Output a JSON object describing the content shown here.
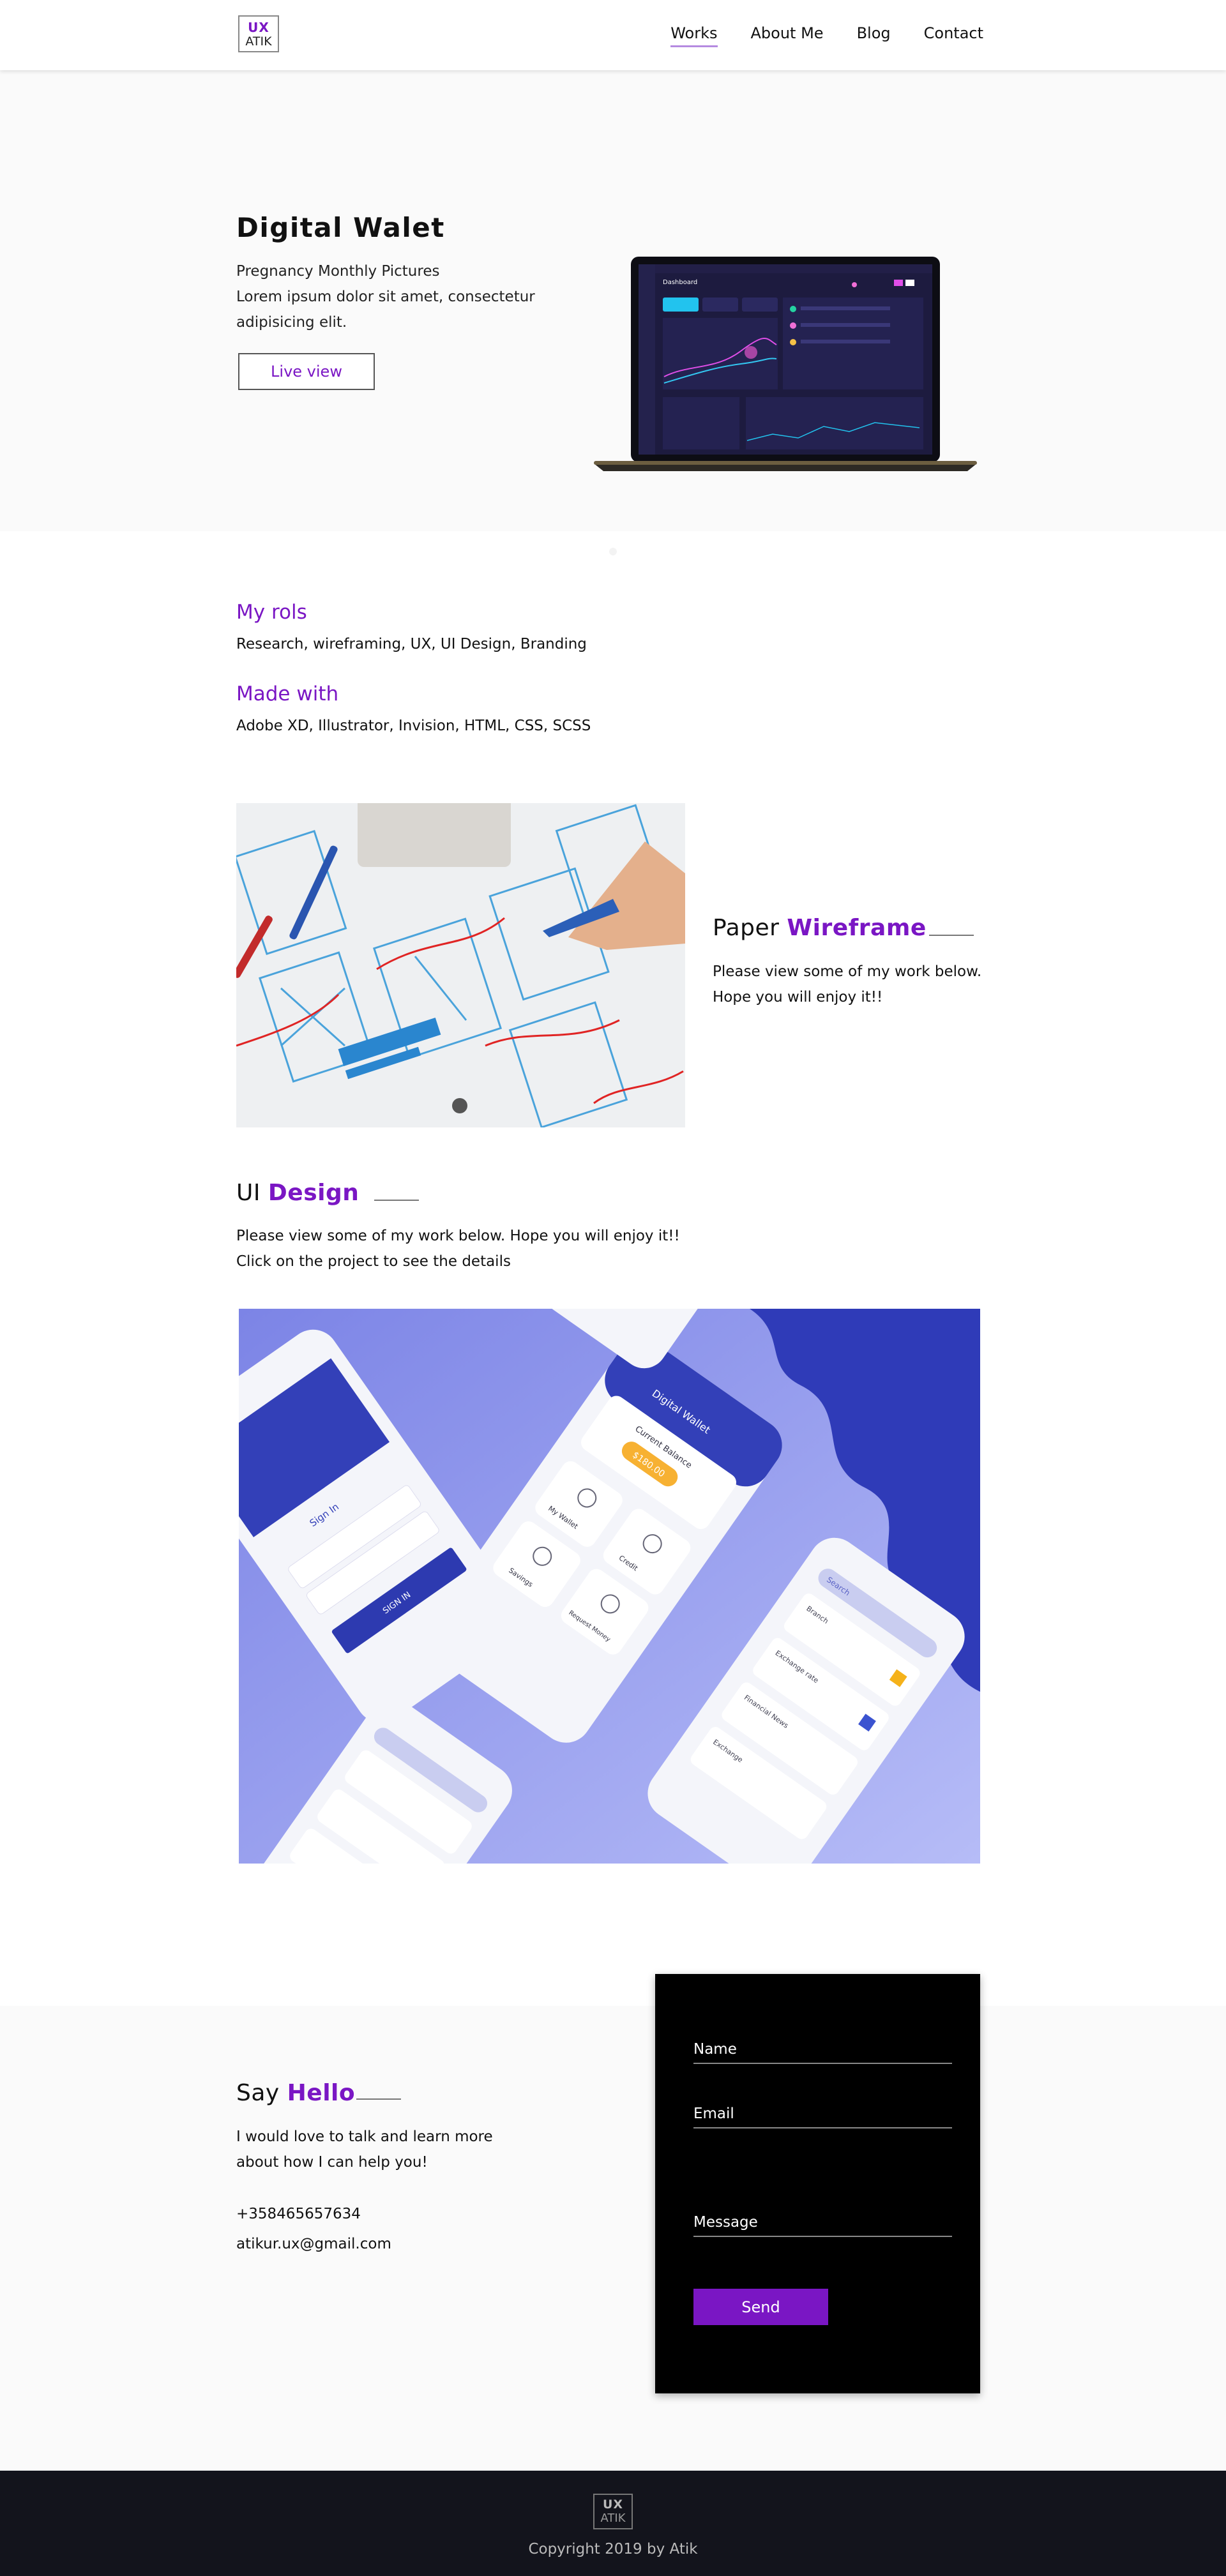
{
  "brand": {
    "logo_top": "UX",
    "logo_bottom": "ATIK"
  },
  "nav": {
    "items": [
      {
        "label": "Works"
      },
      {
        "label": "About Me"
      },
      {
        "label": "Blog"
      },
      {
        "label": "Contact"
      }
    ],
    "active_index": 0
  },
  "hero": {
    "title": "Digital Walet",
    "line1": "Pregnancy Monthly Pictures",
    "line2": "Lorem ipsum dolor sit amet, consectetur",
    "line3": "adipisicing elit.",
    "button": "Live view",
    "screen_title": "Dashboard"
  },
  "roles": {
    "heading": "My rols",
    "text": "Research, wireframing, UX, UI Design, Branding",
    "made_heading": "Made with",
    "made_text": "Adobe XD, Illustrator, Invision, HTML, CSS, SCSS"
  },
  "wireframe": {
    "title_plain": "Paper",
    "title_bold": "Wireframe",
    "line1": "Please view some of my work below.",
    "line2": "Hope you will enjoy it!!"
  },
  "ui_design": {
    "title_plain": "UI",
    "title_bold": "Design",
    "line1": "Please view some of my work below. Hope you will enjoy it!!",
    "line2": "Click on the project to see the details",
    "phone_texts": {
      "sign_in": "Sign In",
      "sign_in_button": "SIGN IN",
      "digital_wallet": "Digital Wallet",
      "current_balance": "Current Balance",
      "balance_value": "$180.00",
      "my_wallet": "My Wallet",
      "credit": "Credit",
      "savings": "Savings",
      "request_money": "Request Money",
      "search": "Search",
      "branch": "Branch",
      "exchange_rate": "Exchange rate",
      "financial_news": "Financial News",
      "exchange": "Exchange"
    }
  },
  "contact": {
    "title_plain": "Say",
    "title_bold": "Hello",
    "line1": "I would love to talk and learn more",
    "line2": "about how I can help you!",
    "phone": "+358465657634",
    "email": "atikur.ux@gmail.com",
    "form": {
      "name": "Name",
      "email": "Email",
      "message": "Message",
      "send": "Send"
    }
  },
  "footer": {
    "logo_top": "UX",
    "logo_bottom": "ATIK",
    "copyright": "Copyright 2019 by Atik"
  },
  "colors": {
    "accent": "#7a16c4",
    "footer_bg": "#13141c",
    "section_bg": "#fafafa"
  }
}
